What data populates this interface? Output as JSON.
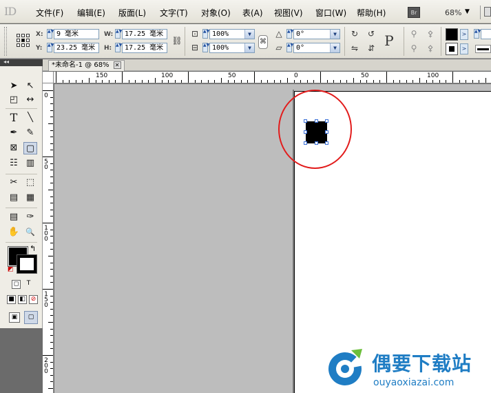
{
  "menubar": {
    "logo": "ID",
    "items": [
      "文件(F)",
      "编辑(E)",
      "版面(L)",
      "文字(T)",
      "对象(O)",
      "表(A)",
      "视图(V)",
      "窗口(W)",
      "帮助(H)"
    ],
    "bridge_label": "Br",
    "zoom": "68%",
    "zoom_arrow": "▼"
  },
  "control": {
    "x_label": "X:",
    "x_value": "9 毫米",
    "y_label": "Y:",
    "y_value": "23.25 毫米",
    "w_label": "W:",
    "w_value": "17.25 毫米",
    "h_label": "H:",
    "h_value": "17.25 毫米",
    "scale_x": "100%",
    "scale_y": "100%",
    "rotate": "0°",
    "shear": "0°",
    "p_label": "P",
    "dd_arrow": "▼",
    "spin_glyph": "▲▼",
    "swatch_arrow": ">"
  },
  "toolbox_header": "◂◂",
  "tab": {
    "title": "*未命名-1 @ 68%",
    "close": "✕"
  },
  "hruler": {
    "labels": [
      "150",
      "100",
      "50",
      "0",
      "50",
      "100"
    ]
  },
  "vruler": {
    "labels": [
      "0",
      "5\n0",
      "1\n0\n0",
      "1\n5\n0",
      "2\n0\n0"
    ]
  },
  "tools": {
    "selection": "➤",
    "direct_selection": "↖",
    "page": "◰",
    "gap": "↔",
    "type": "T",
    "line": "╲",
    "pen": "✒",
    "pencil": "✎",
    "rect_frame": "⊠",
    "rectangle": "▢",
    "h_grid": "☷",
    "v_grid": "▥",
    "scissors": "✂",
    "free_transform": "⬚",
    "gradient": "▤",
    "gradient_feather": "▦",
    "note": "▤",
    "eyedropper": "✑",
    "hand": "✋",
    "zoom": "🔍",
    "swap": "↰",
    "default": "◩",
    "format_container": "◻",
    "format_text": "T",
    "apply_color": "■",
    "apply_gradient": "◧",
    "apply_none": "⊘",
    "normal_view": "▣",
    "preview_view": "▢"
  },
  "watermark": {
    "title": "偶要下载站",
    "domain": "ouyaoxiazai.com"
  },
  "colors": {
    "accent": "#1f7dc4",
    "highlight": "#e21c1c",
    "selection_handle": "#3a6fd8"
  }
}
